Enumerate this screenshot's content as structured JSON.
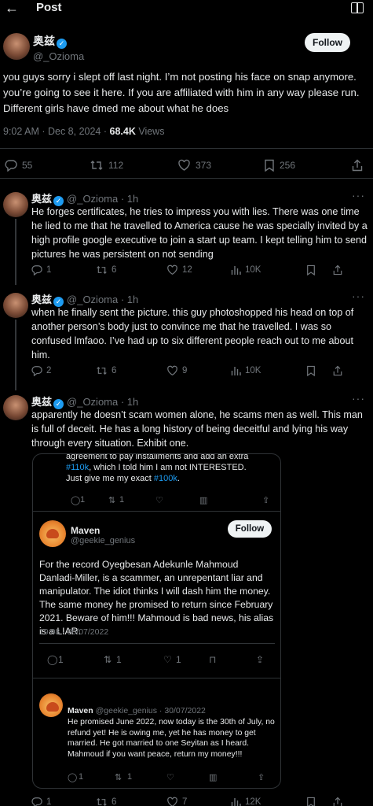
{
  "topbar": {
    "back": "←",
    "title": "Post"
  },
  "main": {
    "name": "奥兹",
    "handle": "@_Ozioma",
    "follow": "Follow",
    "text": "you guys sorry i slept off last night. I’m not posting his face on snap anymore. you’re going to see it here. If you are affiliated with him in any way please run. Different girls have dmed me about what he does",
    "time": "9:02 AM · Dec 8, 2024 ·",
    "views_count": "68.4K",
    "views_label": "Views",
    "stats": {
      "replies": "55",
      "reposts": "112",
      "likes": "373",
      "bookmarks": "256"
    }
  },
  "replies": [
    {
      "name": "奥兹",
      "handle": "@_Ozioma · 1h",
      "text": "He forges certificates, he tries to impress you with lies. There was one time he lied to me that he travelled to America cause he was specially invited by a high profile google executive to join a start up team. I kept telling him to send pictures he was persistent on not sending",
      "replies": "1",
      "reposts": "6",
      "likes": "12",
      "views": "10K"
    },
    {
      "name": "奥兹",
      "handle": "@_Ozioma · 1h",
      "text": "when he finally sent the picture. this guy photoshopped his head on top of another person’s body just to convince me that he travelled. I was so confused lmfaoo. I’ve had up to six different people reach out to me about him.",
      "replies": "2",
      "reposts": "6",
      "likes": "9",
      "views": "10K"
    },
    {
      "name": "奥兹",
      "handle": "@_Ozioma · 1h",
      "text": "apparently he doesn’t scam women alone, he scams men as well. This man is full of deceit. He has a long history of being deceitful and lying his way through every situation.  Exhibit one.",
      "replies": "1",
      "reposts": "6",
      "likes": "7",
      "views": "12K"
    }
  ],
  "quote": {
    "top_text_a": "agreement to pay installments and add an extra",
    "top_hash_1": "#110k",
    "top_text_b": ", which I told him I am not INTERESTED.",
    "top_text_c": "Just give me my exact ",
    "top_hash_2": "#100k",
    "top_text_d": ".",
    "top_actions": {
      "replies": "1",
      "reposts": "1"
    },
    "maven_name": "Maven",
    "maven_handle": "@geekie_genius",
    "follow": "Follow",
    "body": "For the record Oyegbesan Adekunle Mahmoud Danladi-Miller, is a scammer, an unrepentant liar and manipulator. The idiot thinks I will dash him the money. The same money he promised to return since February 2021. Beware of him!!! Mahmoud is bad news, his alias is a LIAR.",
    "time": "19:08 · 30/07/2022",
    "actions": {
      "replies": "1",
      "reposts": "1",
      "likes": "1"
    },
    "reply_name": "Maven",
    "reply_handle": "@geekie_genius · 30/07/2022",
    "reply_text": "He promised June 2022, now today is the 30th of July, no refund yet! He is owing me, yet he has money to get married. He got married to one Seyitan as I heard. Mahmoud if you want peace, return my money!!!",
    "reply_actions": {
      "replies": "1",
      "reposts": "1"
    }
  },
  "colors": {
    "accent": "#1d9bf0",
    "muted": "#71767b",
    "text": "#e7e9ea",
    "bg": "#000000"
  },
  "icons": [
    "back-arrow-icon",
    "reader-icon",
    "verified-icon",
    "reply-icon",
    "repost-icon",
    "like-icon",
    "bookmark-icon",
    "share-icon",
    "views-icon",
    "more-icon"
  ]
}
